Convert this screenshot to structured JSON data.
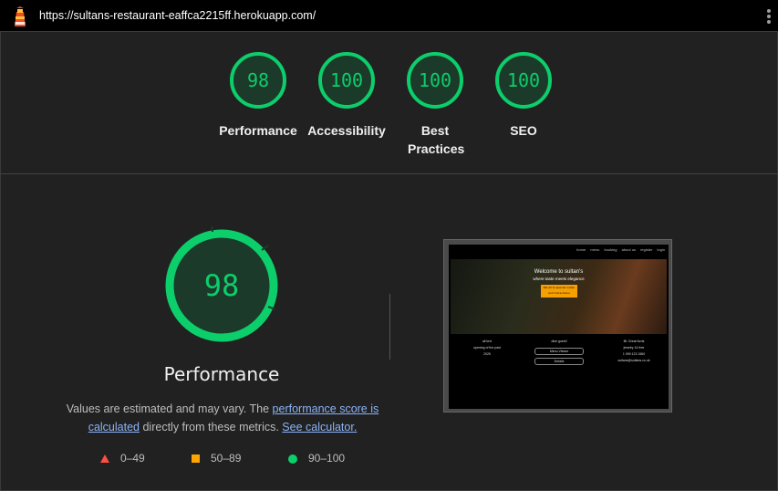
{
  "topbar": {
    "url": "https://sultans-restaurant-eaffca2215ff.herokuapp.com/"
  },
  "summary": [
    {
      "score": "98",
      "label": "Performance"
    },
    {
      "score": "100",
      "label": "Accessibility"
    },
    {
      "score": "100",
      "label": "Best Practices"
    },
    {
      "score": "100",
      "label": "SEO"
    }
  ],
  "main": {
    "score": "98",
    "title": "Performance",
    "note_text1": "Values are estimated and may vary. The ",
    "note_link1": "performance score is calculated",
    "note_text2": " directly from these metrics. ",
    "note_link2": "See calculator."
  },
  "legend": [
    {
      "range": "0–49",
      "color": "#ff4e42"
    },
    {
      "range": "50–89",
      "color": "#ffa400"
    },
    {
      "range": "90–100",
      "color": "#0cce6b"
    }
  ],
  "screenshot": {
    "nav": [
      "home",
      "menu",
      "booking",
      "about us",
      "register",
      "login"
    ],
    "hero_line1": "Welcome to sultan's",
    "hero_line2": "where taste meets elegance",
    "hero_button": "We all to special indian and more menu",
    "footer_left": [
      "all text",
      "opening of the past",
      "2025"
    ],
    "footer_mid_title": "dine guest!",
    "footer_mid_pills": [
      "Menu Viewer",
      "Details"
    ],
    "footer_right": [
      "fill: Great fords",
      "jewelry 14 free",
      "1 999 123 1560",
      "sultans@sultans.co.uk"
    ]
  },
  "colors": {
    "pass": "#0cce6b",
    "average": "#ffa400",
    "fail": "#ff4e42",
    "background": "#212121"
  }
}
